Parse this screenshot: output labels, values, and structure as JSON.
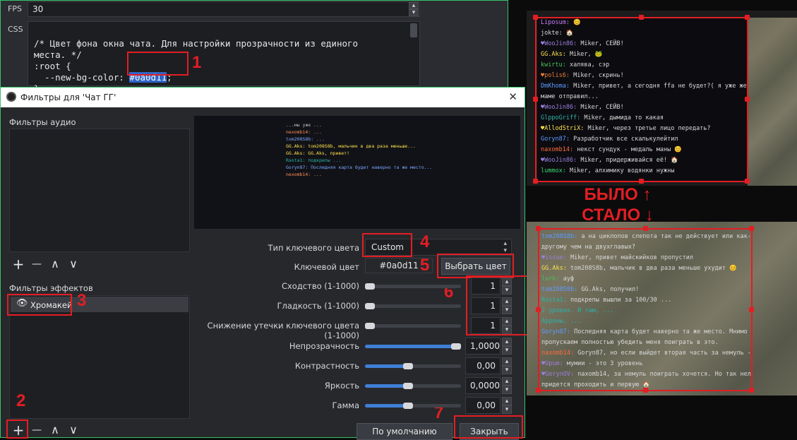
{
  "top_window": {
    "fps_label": "FPS",
    "fps_value": "30",
    "css_label": "CSS",
    "css_lines": [
      "/* Цвет фона окна чата. Для настройки прозрачности из единого",
      "места. */",
      ":root {",
      "  --new-bg-color: ",
      "}"
    ],
    "css_highlight": "#0a0d11",
    "css_semicolon": ";"
  },
  "dialog": {
    "title": "Фильтры для 'Чат ГГ'",
    "close_glyph": "✕",
    "audio_filters_label": "Фильтры аудио",
    "effect_filters_label": "Фильтры эффектов",
    "effect_items": [
      "Хромакей"
    ],
    "eye_icon": "eye-icon",
    "toolbar_glyphs": {
      "add": "+",
      "remove": "—",
      "up": "∧",
      "down": "∨"
    },
    "key_color_type_label": "Тип ключевого цвета",
    "key_color_type_value": "Custom",
    "key_color_label": "Ключевой цвет",
    "key_color_value": "#0a0d11",
    "key_color_swatch": "#0a0d11",
    "pick_color_button": "Выбрать цвет",
    "rows": [
      {
        "label": "Сходство (1-1000)",
        "value": "1",
        "fill": 0.0
      },
      {
        "label": "Гладкость (1-1000)",
        "value": "1",
        "fill": 0.0
      },
      {
        "label": "Снижение утечки ключевого цвета (1-1000)",
        "value": "1",
        "fill": 0.0
      },
      {
        "label": "Непрозрачность",
        "value": "1,0000",
        "fill": 1.0
      },
      {
        "label": "Контрастность",
        "value": "0,00",
        "fill": 0.5
      },
      {
        "label": "Яркость",
        "value": "0,0000",
        "fill": 0.5
      },
      {
        "label": "Гамма",
        "value": "0,00",
        "fill": 0.5
      }
    ],
    "default_button": "По умолчанию",
    "close_button": "Закрыть"
  },
  "preview_chat": [
    "...мы уже ...",
    "nexomb14: ...",
    "tom208S8b: ...",
    "GG.Aks: tom208S8b, мальчик в два раза меньше...",
    "GG.Aks: GG.Aks, привет!",
    "Rasta1: подкрепы ...",
    "Goryn87: Последняя карта будет навернo та же место...",
    "nexomb14: ..."
  ],
  "annotations": {
    "n1": "1",
    "n2": "2",
    "n3": "3",
    "n4": "4",
    "n5": "5",
    "n6": "6",
    "n7": "7",
    "was": "БЫЛО ↑",
    "now": "СТАЛО ↓"
  },
  "before_chat": [
    {
      "user": "Liposum:",
      "text": "😊",
      "color": "#c97cf3"
    },
    {
      "user": "jokte:",
      "text": "🏠",
      "color": "#dcdcdc"
    },
    {
      "user": "♥WooJin86:",
      "text": "Miker, СЕЙВ!",
      "color": "#9c7fe0"
    },
    {
      "user": "GG.Aks:",
      "text": "Miker, 🐸",
      "color": "#ffe24a"
    },
    {
      "user": "kwirtu:",
      "text": "халява, сэр",
      "color": "#49c25b"
    },
    {
      "user": "♥polis6:",
      "text": "Miker, скринь!",
      "color": "#e77b3b"
    },
    {
      "user": "DmKhoma:",
      "text": "Miker, привет, а сегодня ffa не будет?( я уже жену к",
      "color": "#5d9bff"
    },
    {
      "user": "",
      "text": "маме отправил...",
      "color": "#dcdcdc"
    },
    {
      "user": "♥WooJin86:",
      "text": "Miker, СЕЙВ!",
      "color": "#9c7fe0"
    },
    {
      "user": "GlppoGriff:",
      "text": "Miker, дымида то какая",
      "color": "#2ab3a8"
    },
    {
      "user": "♥AllodStriX:",
      "text": "Miker, через третье лицо передать?",
      "color": "#ffe24a"
    },
    {
      "user": "Goryn87:",
      "text": "Разработчик все скалькулейтил",
      "color": "#5d9bff"
    },
    {
      "user": "naxomb14:",
      "text": "некст сундук - медаль маны 😊",
      "color": "#ff6b3c"
    },
    {
      "user": "♥WooJin86:",
      "text": "Miker, придерживайся её! 🏠",
      "color": "#9c7fe0"
    },
    {
      "user": "lummox:",
      "text": "Miker, алхимику водянки нужны",
      "color": "#3ad66f"
    }
  ],
  "after_chat": [
    {
      "user": "tom208S8b:",
      "text": "а на циклопов слепота так не действует или как-то по",
      "color": "#5d9bff"
    },
    {
      "user": "",
      "text": "другому чем на двухглавых?",
      "color": "#dcdcdc"
    },
    {
      "user": "♥issue:",
      "text": "Miker, привет майскийков пропустил",
      "color": "#9c7fe0"
    },
    {
      "user": "GG.Aks:",
      "text": "tom208S8b, мальчик в два раза меньше ухудит 😊",
      "color": "#ffe24a"
    },
    {
      "user": "lurk:",
      "text": "ауф",
      "color": "#49c25b"
    },
    {
      "user": "tom208S8b:",
      "text": "GG.Aks, получил!",
      "color": "#5d9bff"
    },
    {
      "user": "Rasta1:",
      "text": "подкрепы вышли за 100/30 ...",
      "color": "#2ab3a8"
    },
    {
      "user": "",
      "text": "2 уровня. И там, ...",
      "color": "#2ab3a8"
    },
    {
      "user": "",
      "text": "Арроны, ...",
      "color": "#2ab3a8"
    },
    {
      "user": "Goryn87:",
      "text": "Последняя карта будет наверно та же место. Мнимо",
      "color": "#5d9bff"
    },
    {
      "user": "",
      "text": "пропускаем полностью убедить меня поиграть в это.",
      "color": "#dcdcdc"
    },
    {
      "user": "naxomb14:",
      "text": "Goryn87, но если выйдет вторая часть за немуль - и?",
      "color": "#ff6b3c"
    },
    {
      "user": "♥Upum:",
      "text": "мумии - это 3 уровень",
      "color": "#9c7fe0"
    },
    {
      "user": "♥GorynOV:",
      "text": "naxomb14, за немуль поиграть хочется. Но так нельзя,",
      "color": "#9c7fe0"
    },
    {
      "user": "",
      "text": "придется проходить и первую 🏠",
      "color": "#dcdcdc"
    }
  ]
}
